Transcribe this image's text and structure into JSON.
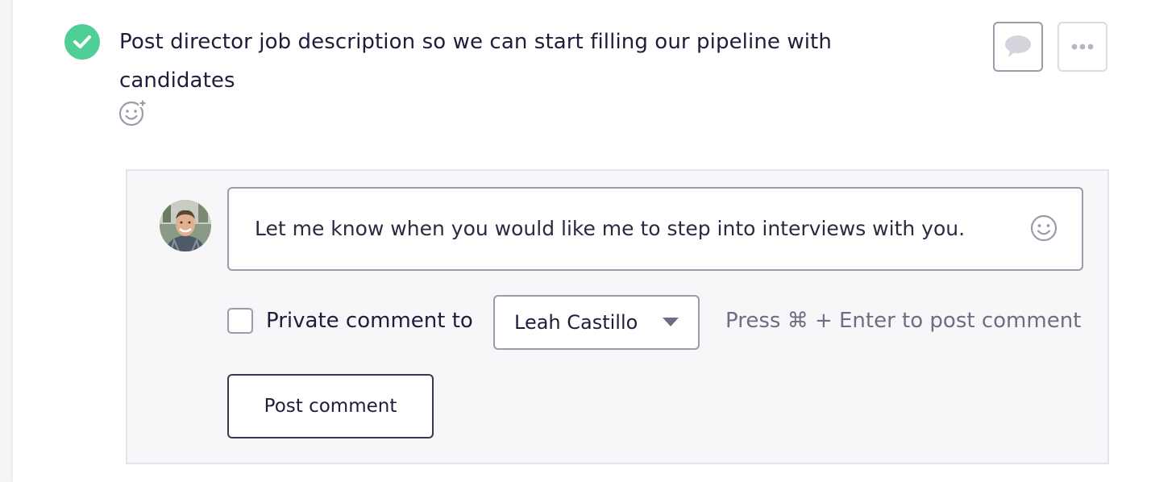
{
  "task": {
    "title": "Post director job description so we can start filling our pipeline with candidates",
    "status": "completed",
    "status_color": "#4fcf95",
    "status_icon": "checkmark-icon",
    "reaction_icon": "add-reaction-icon"
  },
  "actions": {
    "comment_icon": "speech-bubble-icon",
    "more_icon": "more-options-icon"
  },
  "comment_form": {
    "avatar_icon": "user-avatar",
    "input_value": "Let me know when you would like me to step into interviews with you.",
    "emoji_icon": "smiley-icon",
    "private_label": "Private comment to",
    "private_checked": false,
    "recipient": "Leah Castillo",
    "hint": "Press ⌘ + Enter to post comment",
    "submit_label": "Post comment"
  }
}
